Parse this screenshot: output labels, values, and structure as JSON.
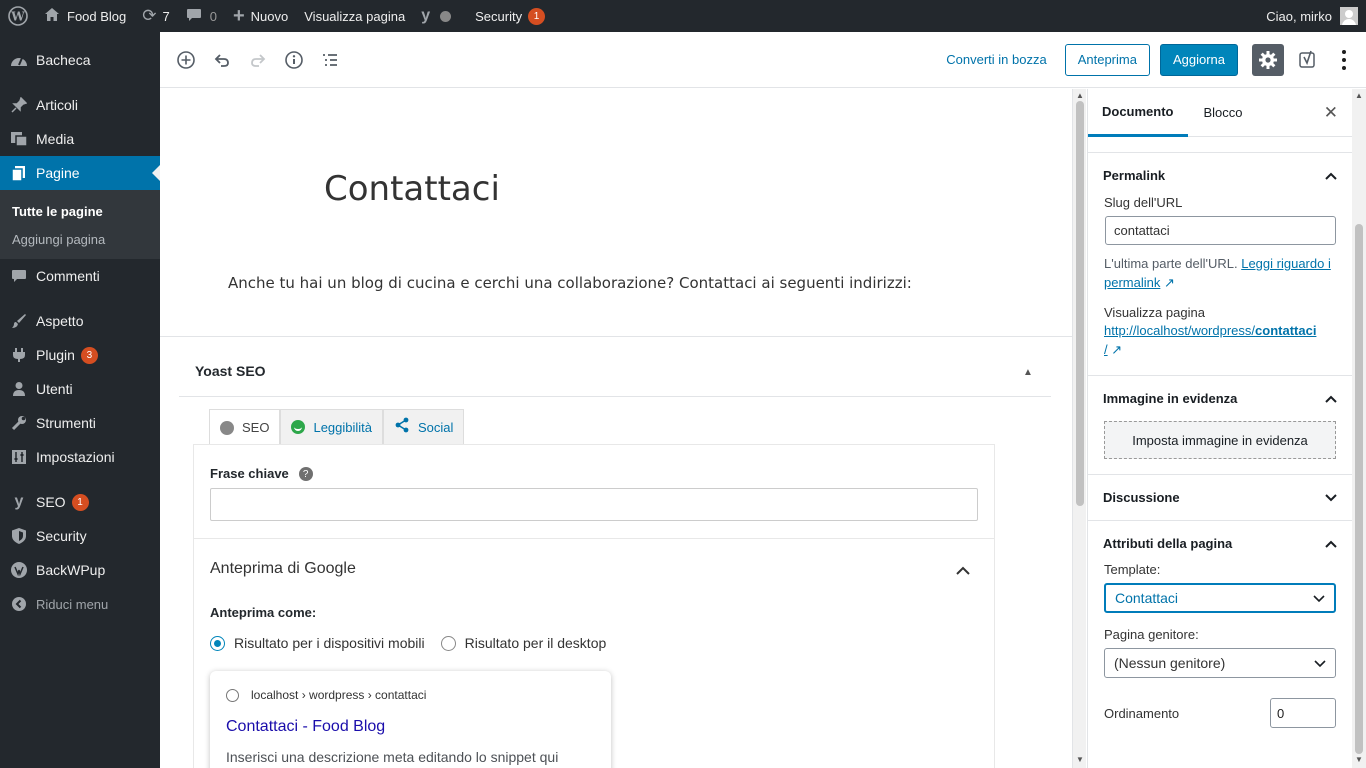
{
  "adminbar": {
    "site_name": "Food Blog",
    "updates_count": "7",
    "comments_count": "0",
    "new_label": "Nuovo",
    "view_page_label": "Visualizza pagina",
    "security_label": "Security",
    "security_badge": "1",
    "greeting": "Ciao, mirko"
  },
  "sidebar": {
    "items": [
      {
        "label": "Bacheca",
        "icon": "dashboard-icon"
      },
      {
        "label": "Articoli",
        "icon": "pin-icon"
      },
      {
        "label": "Media",
        "icon": "media-icon"
      },
      {
        "label": "Pagine",
        "icon": "pages-icon"
      },
      {
        "label": "Commenti",
        "icon": "comments-icon"
      },
      {
        "label": "Aspetto",
        "icon": "brush-icon"
      },
      {
        "label": "Plugin",
        "icon": "plugin-icon",
        "badge": "3"
      },
      {
        "label": "Utenti",
        "icon": "users-icon"
      },
      {
        "label": "Strumenti",
        "icon": "wrench-icon"
      },
      {
        "label": "Impostazioni",
        "icon": "settings-icon"
      },
      {
        "label": "SEO",
        "icon": "yoast-icon",
        "badge": "1"
      },
      {
        "label": "Security",
        "icon": "shield-icon"
      },
      {
        "label": "BackWPup",
        "icon": "backwpup-icon"
      }
    ],
    "submenu": [
      "Tutte le pagine",
      "Aggiungi pagina"
    ],
    "collapse_label": "Riduci menu"
  },
  "toolbar": {
    "convert_draft": "Converti in bozza",
    "preview": "Anteprima",
    "update": "Aggiorna"
  },
  "post": {
    "title": "Contattaci",
    "paragraph": "Anche tu hai un blog di cucina e cerchi una collaborazione? Contattaci ai seguenti indirizzi:"
  },
  "yoast": {
    "title": "Yoast SEO",
    "tabs": [
      "SEO",
      "Leggibilità",
      "Social"
    ],
    "keyphrase_label": "Frase chiave",
    "google_preview_title": "Anteprima di Google",
    "preview_as": "Anteprima come:",
    "radio_mobile": "Risultato per i dispositivi mobili",
    "radio_desktop": "Risultato per il desktop",
    "serp_url": "localhost › wordpress › contattaci",
    "serp_title": "Contattaci - Food Blog",
    "serp_desc": "Inserisci una descrizione meta editando lo snippet qui"
  },
  "panel": {
    "tab_document": "Documento",
    "tab_block": "Blocco",
    "permalink": {
      "title": "Permalink",
      "slug_label": "Slug dell'URL",
      "slug_value": "contattaci",
      "help_text": "L'ultima parte dell'URL.",
      "help_link_1": "Leggi riguardo i",
      "help_link_2": "permalink",
      "view_label": "Visualizza pagina",
      "url_prefix": "http://localhost/wordpress/",
      "url_slug": "contattaci",
      "url_suffix": "/"
    },
    "featured": {
      "title": "Immagine in evidenza",
      "button": "Imposta immagine in evidenza"
    },
    "discussion": {
      "title": "Discussione"
    },
    "attributes": {
      "title": "Attributi della pagina",
      "template_label": "Template:",
      "template_value": "Contattaci",
      "parent_label": "Pagina genitore:",
      "parent_value": "(Nessun genitore)",
      "order_label": "Ordinamento",
      "order_value": "0"
    }
  },
  "colors": {
    "admin_dark": "#23282d",
    "accent": "#0073aa",
    "primary_button": "#0085ba",
    "badge": "#d54e21"
  }
}
